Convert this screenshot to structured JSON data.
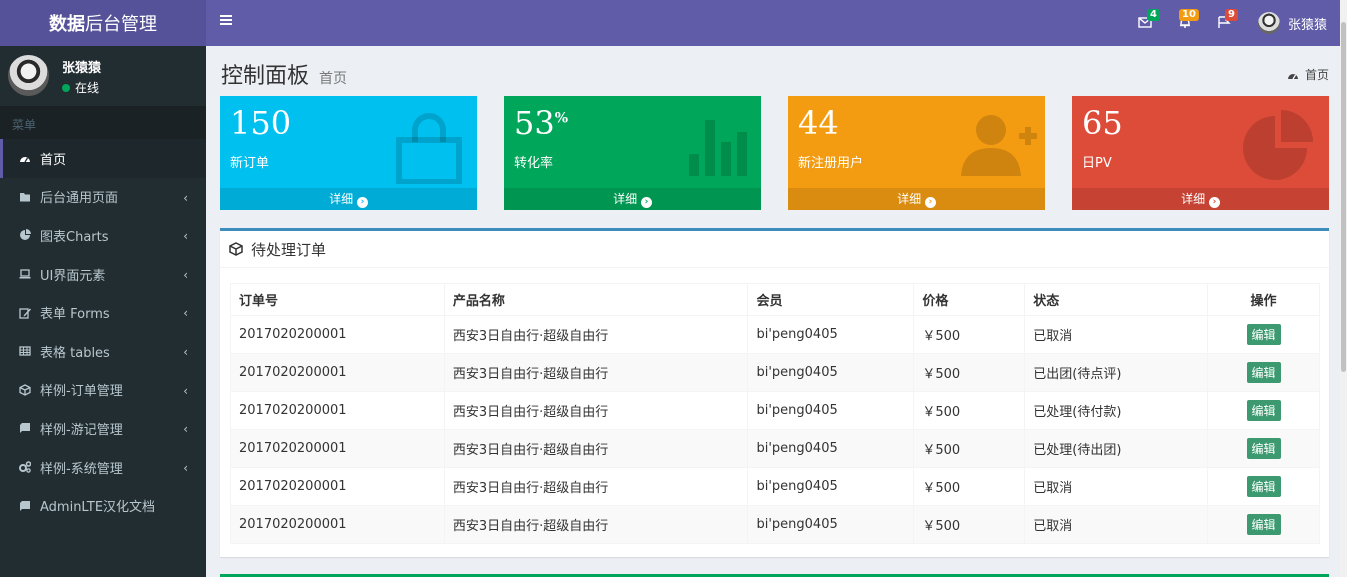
{
  "brand": {
    "bold": "数据",
    "rest": "后台管理"
  },
  "topbar": {
    "mail_count": "4",
    "mail_color": "#00a65a",
    "bell_count": "10",
    "bell_color": "#f39c12",
    "flag_count": "9",
    "flag_color": "#dd4b39",
    "user": "张猿猿"
  },
  "sidebar": {
    "user": "张猿猿",
    "status": "在线",
    "menu_header": "菜单",
    "items": [
      {
        "label": "首页",
        "icon": "dashboard-icon"
      },
      {
        "label": "后台通用页面",
        "icon": "folder-icon"
      },
      {
        "label": "图表Charts",
        "icon": "pie-chart-icon"
      },
      {
        "label": "UI界面元素",
        "icon": "laptop-icon"
      },
      {
        "label": "表单 Forms",
        "icon": "edit-icon"
      },
      {
        "label": "表格 tables",
        "icon": "table-icon"
      },
      {
        "label": "样例-订单管理",
        "icon": "cube-icon"
      },
      {
        "label": "样例-游记管理",
        "icon": "book-icon"
      },
      {
        "label": "样例-系统管理",
        "icon": "cogs-icon"
      },
      {
        "label": "AdminLTE汉化文档",
        "icon": "book-icon"
      }
    ]
  },
  "page": {
    "title": "控制面板",
    "subtitle": "首页",
    "breadcrumb": "首页"
  },
  "stats": [
    {
      "value": "150",
      "suffix": "",
      "label": "新订单",
      "more": "详细",
      "color": "#00c0ef",
      "icon": "shopping-bag-icon"
    },
    {
      "value": "53",
      "suffix": "%",
      "label": "转化率",
      "more": "详细",
      "color": "#00a65a",
      "icon": "bar-chart-icon"
    },
    {
      "value": "44",
      "suffix": "",
      "label": "新注册用户",
      "more": "详细",
      "color": "#f39c12",
      "icon": "user-plus-icon"
    },
    {
      "value": "65",
      "suffix": "",
      "label": "日PV",
      "more": "详细",
      "color": "#dd4b39",
      "icon": "pie-chart-icon"
    }
  ],
  "orders": {
    "title": "待处理订单",
    "headers": [
      "订单号",
      "产品名称",
      "会员",
      "价格",
      "状态",
      "操作"
    ],
    "edit_label": "编辑",
    "rows": [
      [
        "2017020200001",
        "西安3日自由行·超级自由行",
        "bi'peng0405",
        "￥500",
        "已取消"
      ],
      [
        "2017020200001",
        "西安3日自由行·超级自由行",
        "bi'peng0405",
        "￥500",
        "已出团(待点评)"
      ],
      [
        "2017020200001",
        "西安3日自由行·超级自由行",
        "bi'peng0405",
        "￥500",
        "已处理(待付款)"
      ],
      [
        "2017020200001",
        "西安3日自由行·超级自由行",
        "bi'peng0405",
        "￥500",
        "已处理(待出团)"
      ],
      [
        "2017020200001",
        "西安3日自由行·超级自由行",
        "bi'peng0405",
        "￥500",
        "已取消"
      ],
      [
        "2017020200001",
        "西安3日自由行·超级自由行",
        "bi'peng0405",
        "￥500",
        "已取消"
      ]
    ]
  }
}
